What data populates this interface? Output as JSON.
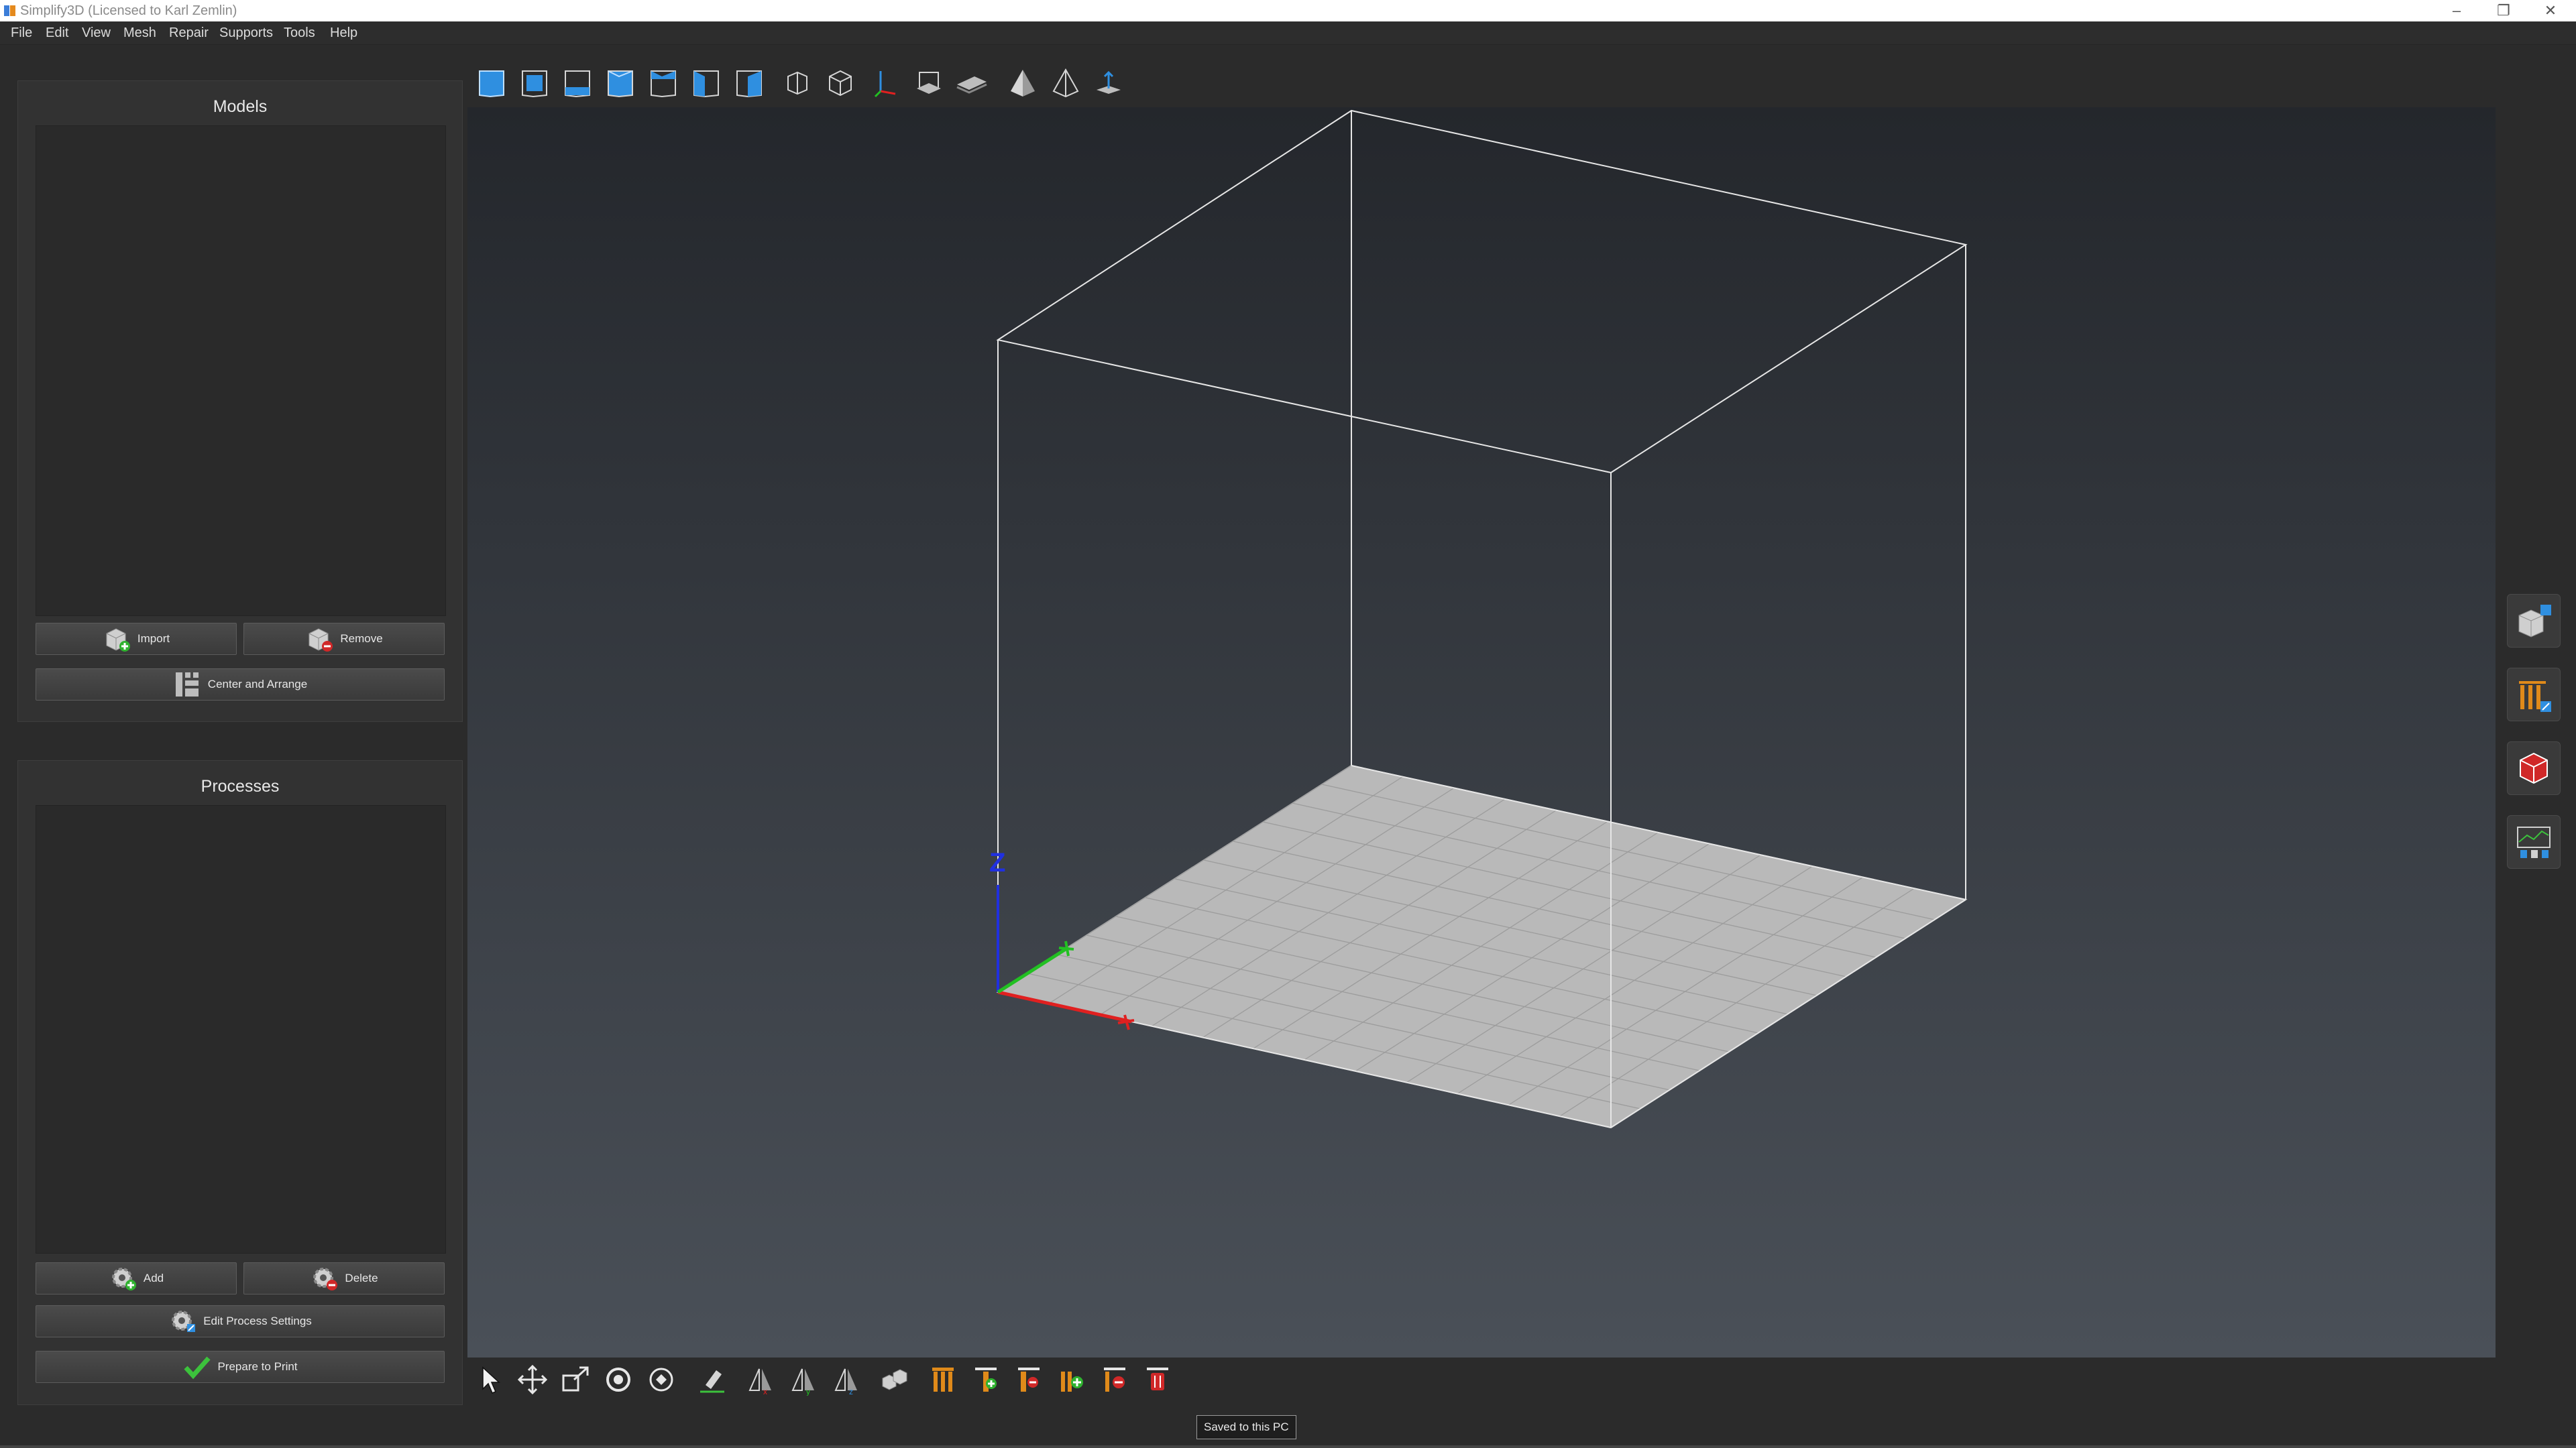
{
  "window": {
    "title": "Simplify3D (Licensed to Karl Zemlin)"
  },
  "menu": [
    "File",
    "Edit",
    "View",
    "Mesh",
    "Repair",
    "Supports",
    "Tools",
    "Help"
  ],
  "models_panel": {
    "title": "Models",
    "import_label": "Import",
    "remove_label": "Remove",
    "center_label": "Center and Arrange"
  },
  "processes_panel": {
    "title": "Processes",
    "add_label": "Add",
    "delete_label": "Delete",
    "edit_label": "Edit Process Settings",
    "prepare_label": "Prepare to Print"
  },
  "viewport": {
    "z_axis_label": "Z"
  },
  "status": {
    "tooltip": "Saved to this PC"
  },
  "colors": {
    "accent_blue": "#2f8fe0",
    "axis_x": "#e02020",
    "axis_y": "#22c022",
    "axis_z": "#2030e0",
    "support_orange": "#e08a1a",
    "check_green": "#3cc23c"
  },
  "top_toolbar_icons": [
    "view-default-icon",
    "view-front-icon",
    "view-back-icon",
    "view-left-icon",
    "view-right-icon",
    "view-top-icon",
    "view-bottom-icon",
    "perspective-icon",
    "orthographic-icon",
    "axes-toggle-icon",
    "build-volume-icon",
    "build-platform-icon",
    "section-view-icon",
    "cross-section-icon",
    "cutaway-plane-icon"
  ],
  "bottom_toolbar_icons": [
    "select-tool-icon",
    "move-tool-icon",
    "scale-tool-icon",
    "rotate-tool-icon",
    "view-rotate-icon",
    "place-face-icon",
    "mirror-x-icon",
    "mirror-y-icon",
    "mirror-z-icon",
    "duplicate-model-icon",
    "support-generate-icon",
    "support-add-icon",
    "support-remove-icon",
    "support-add-all-icon",
    "support-remove-all-icon",
    "support-clear-icon"
  ],
  "side_toolbar_icons": [
    "model-settings-icon",
    "support-settings-icon",
    "variable-settings-icon",
    "machine-control-icon"
  ]
}
